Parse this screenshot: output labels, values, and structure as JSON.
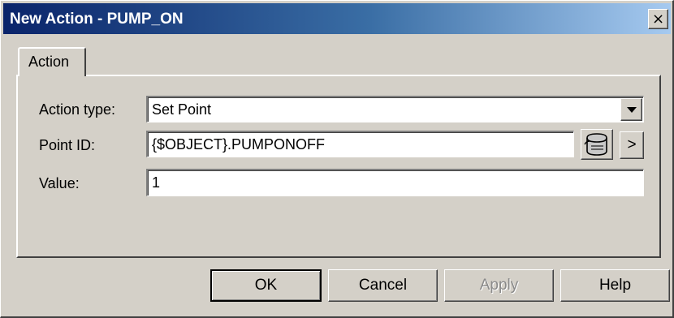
{
  "window": {
    "title": "New Action - PUMP_ON",
    "close_glyph": "×"
  },
  "tabs": [
    {
      "label": "Action",
      "selected": true
    }
  ],
  "form": {
    "action_type": {
      "label": "Action type:",
      "value": "Set Point"
    },
    "point_id": {
      "label": "Point ID:",
      "value": "{$OBJECT}.PUMPONOFF",
      "browse_icon": "point-browser-icon",
      "more_glyph": ">"
    },
    "value": {
      "label": "Value:",
      "value": "1"
    }
  },
  "buttons": {
    "ok": "OK",
    "cancel": "Cancel",
    "apply": "Apply",
    "help": "Help"
  },
  "colors": {
    "face": "#d4d0c8",
    "title_start": "#0a246a",
    "title_end": "#a6caf0",
    "disabled_text": "#8a8a8a"
  }
}
